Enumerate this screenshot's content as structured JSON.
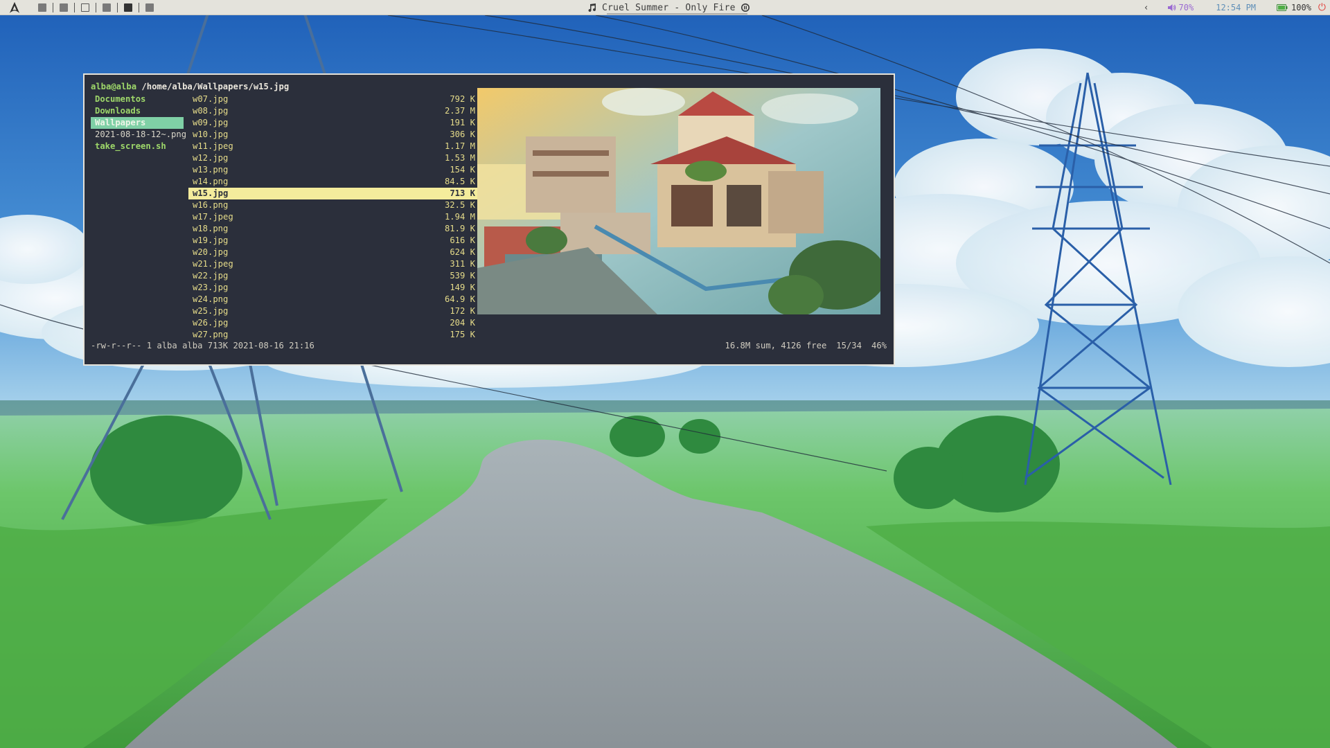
{
  "topbar": {
    "logo_icon": "arch-logo-icon",
    "workspaces": [
      "filled",
      "filled",
      "outline",
      "filled",
      "active",
      "filled"
    ],
    "now_playing": "Cruel Summer - Only Fire",
    "nav_arrow": "‹",
    "volume": "70%",
    "clock": "12:54 PM",
    "battery": "100%",
    "power_icon": "power-icon",
    "colors": {
      "volume": "#9a6ad2",
      "clock": "#5f8fb8",
      "power": "#e0403a"
    }
  },
  "ranger": {
    "user": "alba@alba",
    "path": "/home/alba/Wallpapers/w15.jpg",
    "parent_items": [
      {
        "label": "Documentos",
        "kind": "dir"
      },
      {
        "label": "Downloads",
        "kind": "dir"
      },
      {
        "label": "Wallpapers",
        "kind": "dir-selected"
      },
      {
        "label": "2021-08-18-12~.png",
        "kind": "file"
      },
      {
        "label": "take_screen.sh",
        "kind": "exec"
      }
    ],
    "files": [
      {
        "name": "w07.jpg",
        "size": "792 K"
      },
      {
        "name": "w08.jpg",
        "size": "2.37 M"
      },
      {
        "name": "w09.jpg",
        "size": "191 K"
      },
      {
        "name": "w10.jpg",
        "size": "306 K"
      },
      {
        "name": "w11.jpeg",
        "size": "1.17 M"
      },
      {
        "name": "w12.jpg",
        "size": "1.53 M"
      },
      {
        "name": "w13.png",
        "size": "154 K"
      },
      {
        "name": "w14.png",
        "size": "84.5 K"
      },
      {
        "name": "w15.jpg",
        "size": "713 K"
      },
      {
        "name": "w16.png",
        "size": "32.5 K"
      },
      {
        "name": "w17.jpeg",
        "size": "1.94 M"
      },
      {
        "name": "w18.png",
        "size": "81.9 K"
      },
      {
        "name": "w19.jpg",
        "size": "616 K"
      },
      {
        "name": "w20.jpg",
        "size": "624 K"
      },
      {
        "name": "w21.jpeg",
        "size": "311 K"
      },
      {
        "name": "w22.jpg",
        "size": "539 K"
      },
      {
        "name": "w23.jpg",
        "size": "149 K"
      },
      {
        "name": "w24.png",
        "size": "64.9 K"
      },
      {
        "name": "w25.jpg",
        "size": "172 K"
      },
      {
        "name": "w26.jpg",
        "size": "204 K"
      },
      {
        "name": "w27.png",
        "size": "175 K"
      }
    ],
    "selected_file": "w15.jpg",
    "status_left": "-rw-r--r-- 1 alba alba 713K 2021-08-16 21:16",
    "status_sum": "16.8M sum, 4126 free",
    "status_pos": "15/34",
    "status_pct": "46%"
  }
}
